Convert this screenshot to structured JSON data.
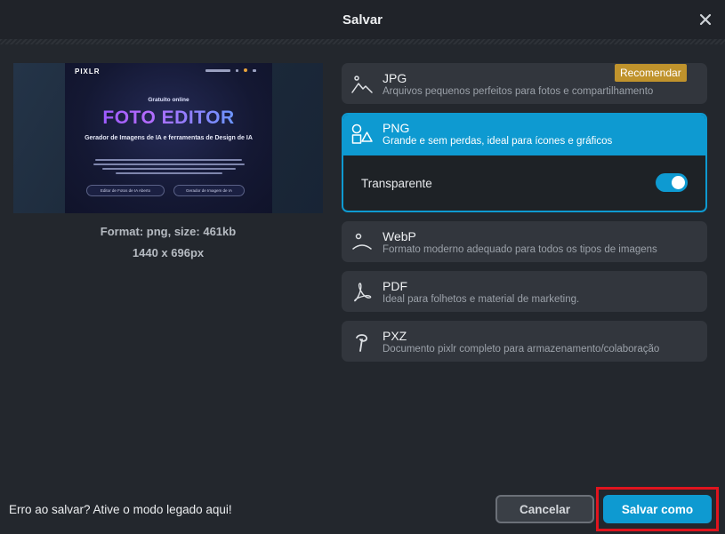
{
  "dialog": {
    "title": "Salvar",
    "close_icon": "close-icon"
  },
  "preview": {
    "site": {
      "logo": "PIXLR",
      "kicker": "Gratuito online",
      "headline": "FOTO EDITOR",
      "subtitle": "Gerador de Imagens de IA e ferramentas de Design de IA",
      "button_left": "Editor de Fotos de IA Aberto",
      "button_right": "Gerador de Imagem de IA"
    },
    "format_info": "Format: png, size: 461kb",
    "dimensions": "1440 x 696px"
  },
  "formats": [
    {
      "name": "JPG",
      "description": "Arquivos pequenos perfeitos para fotos e compartilhamento",
      "icon": "landscape-icon",
      "badge": "Recomendar"
    },
    {
      "name": "PNG",
      "description": "Grande e sem perdas, ideal para ícones e gráficos",
      "icon": "shapes-icon",
      "selected": true,
      "option_label": "Transparente",
      "option_enabled": true
    },
    {
      "name": "WebP",
      "description": "Formato moderno adequado para todos os tipos de imagens",
      "icon": "web-icon"
    },
    {
      "name": "PDF",
      "description": "Ideal para folhetos e material de marketing.",
      "icon": "pdf-icon"
    },
    {
      "name": "PXZ",
      "description": "Documento pixlr completo para armazenamento/colaboração",
      "icon": "pixlr-icon"
    }
  ],
  "footer": {
    "legacy_text": "Erro ao salvar? Ative o modo legado aqui!",
    "cancel_label": "Cancelar",
    "save_as_label": "Salvar como"
  },
  "colors": {
    "accent": "#0e9ad1",
    "badge": "#c0932c",
    "highlight": "#e0141e",
    "background": "#23272d"
  }
}
